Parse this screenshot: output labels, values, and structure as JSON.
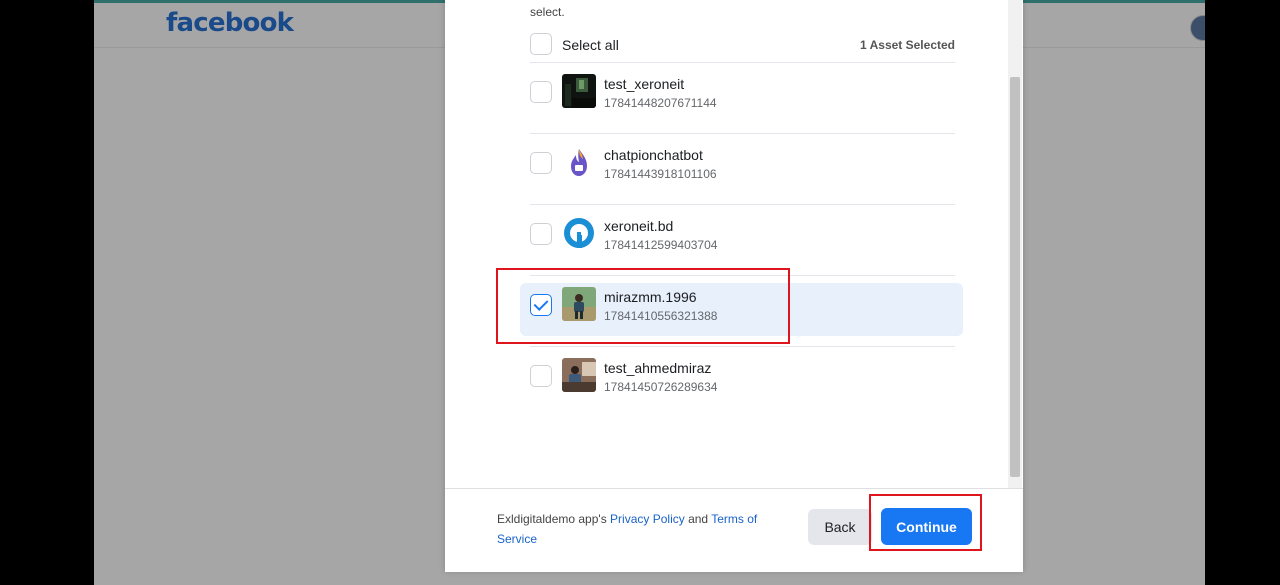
{
  "header": {
    "logo_text": "facebook"
  },
  "dialog": {
    "intro_text": "select.",
    "select_all_label": "Select all",
    "selected_count": "1 Asset Selected",
    "assets": [
      {
        "name": "test_xeroneit",
        "id": "17841448207671144",
        "checked": false,
        "avatar_icon": "dark-photo-thumbnail"
      },
      {
        "name": "chatpionchatbot",
        "id": "17841443918101106",
        "checked": false,
        "avatar_icon": "purple-flame-logo"
      },
      {
        "name": "xeroneit.bd",
        "id": "17841412599403704",
        "checked": false,
        "avatar_icon": "blue-ring-logo"
      },
      {
        "name": "mirazmm.1996",
        "id": "17841410556321388",
        "checked": true,
        "avatar_icon": "person-photo-thumbnail"
      },
      {
        "name": "test_ahmedmiraz",
        "id": "17841450726289634",
        "checked": false,
        "avatar_icon": "person-desk-photo-thumbnail"
      }
    ],
    "footer": {
      "app_prefix": "Exldigital",
      "text_1": "demo app's",
      "privacy_link": "Privacy Policy",
      "and_text": "and",
      "terms_link": "Terms of Service"
    },
    "back_label": "Back",
    "continue_label": "Continue"
  },
  "colors": {
    "primary": "#1877f2",
    "annotation": "#e0141c",
    "selected_row": "#e7f0fb"
  }
}
